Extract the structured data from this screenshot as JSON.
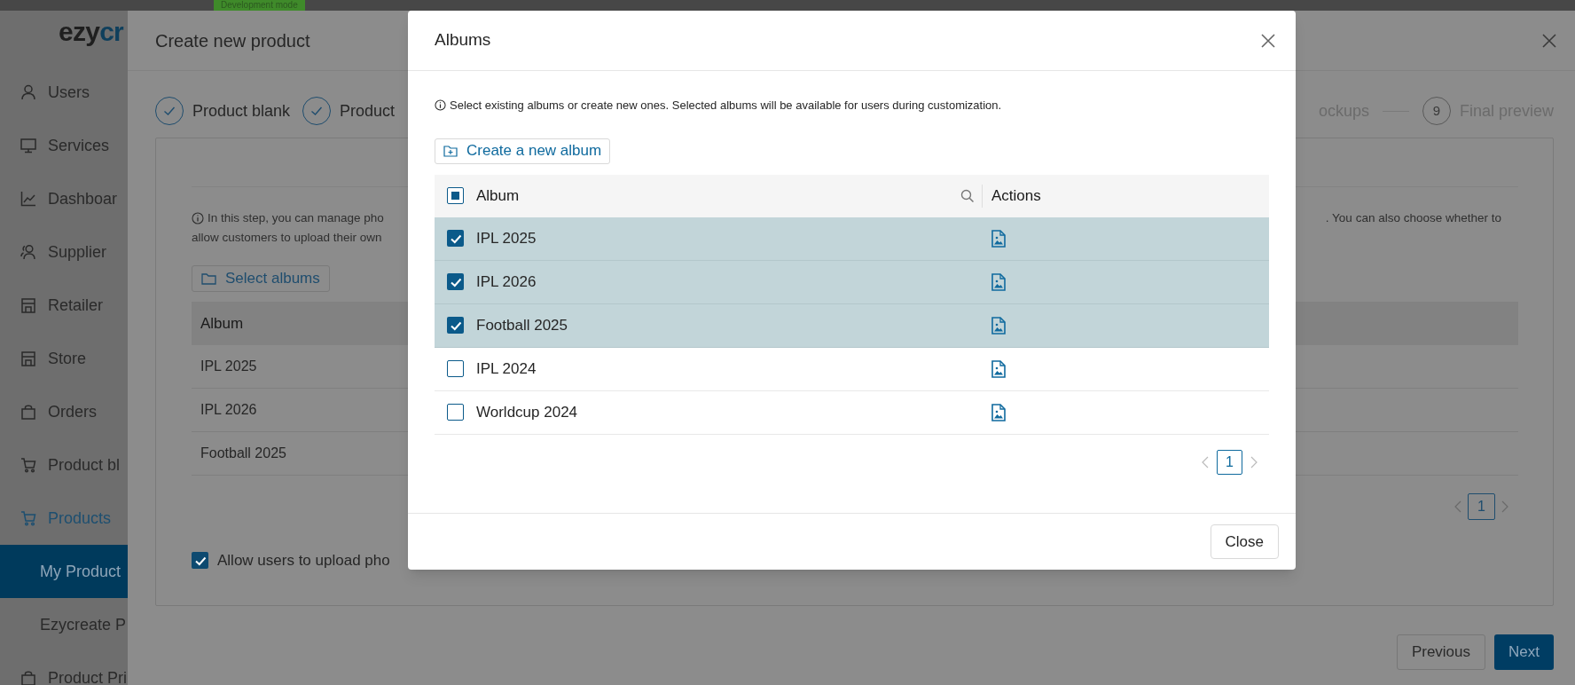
{
  "dev_badge": "Development mode",
  "logo": {
    "text_1": "ezy",
    "text_2": "cr"
  },
  "sidebar": {
    "items": [
      {
        "label": "Users",
        "kind": "item",
        "selected": false
      },
      {
        "label": "Services",
        "kind": "item",
        "selected": false
      },
      {
        "label": "Dashboar",
        "kind": "item",
        "selected": false
      },
      {
        "label": "Supplier",
        "kind": "item",
        "selected": false
      },
      {
        "label": "Retailer",
        "kind": "item",
        "selected": false
      },
      {
        "label": "Store",
        "kind": "item",
        "selected": false
      },
      {
        "label": "Orders",
        "kind": "item",
        "selected": false
      },
      {
        "label": "Product bl",
        "kind": "item",
        "selected": false
      },
      {
        "label": "Products",
        "kind": "parent",
        "selected": false
      },
      {
        "label": "My Product",
        "kind": "subitem",
        "selected": true
      },
      {
        "label": "Ezycreate P",
        "kind": "subitem",
        "selected": false
      },
      {
        "label": "Product Pri",
        "kind": "item",
        "selected": false
      }
    ]
  },
  "product_dialog": {
    "title": "Create new product",
    "steps_start": [
      {
        "label": "Product blank",
        "done": true
      },
      {
        "label": "Product",
        "done": true
      }
    ],
    "steps_end": [
      {
        "label": "ockups",
        "done": false
      },
      {
        "number": "9",
        "label": "Final preview",
        "done": false
      }
    ],
    "info_lines": [
      "In this step, you can manage pho",
      "allow customers to upload their own"
    ],
    "info_end": ". You can also choose whether to",
    "select_button": "Select albums",
    "table": {
      "columns": [
        "Album"
      ],
      "rows": [
        {
          "album": "IPL 2025"
        },
        {
          "album": "IPL 2026"
        },
        {
          "album": "Football 2025"
        }
      ]
    },
    "page": "1",
    "allow_upload": {
      "label": "Allow users to upload pho",
      "checked": true
    },
    "buttons": [
      {
        "label": "Previous",
        "kind": "secondary"
      },
      {
        "label": "Next",
        "kind": "primary"
      }
    ]
  },
  "albums_dialog": {
    "title": "Albums",
    "info": "Select existing albums or create new ones. Selected albums will be available for users during customization.",
    "create_button": "Create a new album",
    "columns": [
      "Album",
      "Actions"
    ],
    "select_all_indeterminate": true,
    "rows": [
      {
        "album": "IPL 2025",
        "selected": true
      },
      {
        "album": "IPL 2026",
        "selected": true
      },
      {
        "album": "Football 2025",
        "selected": true
      },
      {
        "album": "IPL 2024",
        "selected": false
      },
      {
        "album": "Worldcup 2024",
        "selected": false
      }
    ],
    "page": "1",
    "close_button": "Close"
  }
}
